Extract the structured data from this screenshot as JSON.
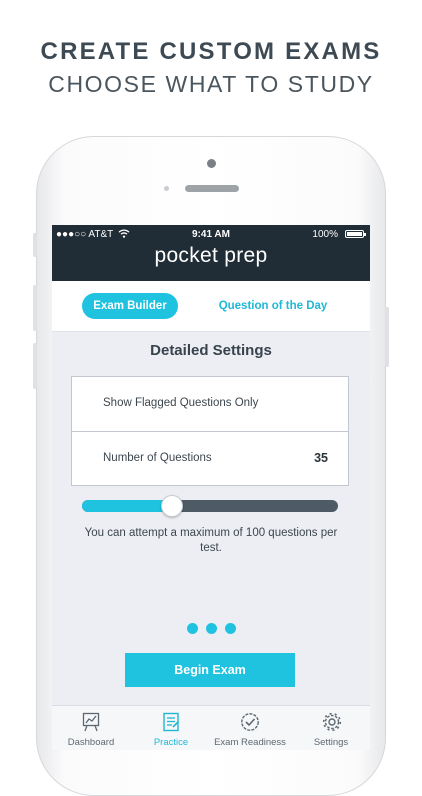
{
  "marketing": {
    "headline": "CREATE CUSTOM EXAMS",
    "subheadline": "CHOOSE WHAT TO STUDY"
  },
  "status_bar": {
    "carrier": "●●●○○ AT&T",
    "time": "9:41 AM",
    "battery": "100%"
  },
  "app": {
    "brand": "pocket prep"
  },
  "tabs": {
    "active": "Exam Builder",
    "inactive": "Question of the Day"
  },
  "settings": {
    "title": "Detailed Settings",
    "flagged_label": "Show Flagged Questions Only",
    "questions_label": "Number of Questions",
    "questions_value": "35",
    "slider_fraction": 0.35,
    "note": "You can attempt a maximum of 100 questions per test."
  },
  "actions": {
    "begin": "Begin Exam"
  },
  "tabbar": {
    "items": [
      {
        "label": "Dashboard",
        "icon": "chart-board-icon"
      },
      {
        "label": "Practice",
        "icon": "practice-clipboard-icon"
      },
      {
        "label": "Exam Readiness",
        "icon": "check-badge-icon"
      },
      {
        "label": "Settings",
        "icon": "gear-icon"
      }
    ],
    "active_index": 1
  },
  "colors": {
    "accent": "#1fc3e0",
    "header": "#212d36",
    "slider_track": "#4e5b66"
  }
}
